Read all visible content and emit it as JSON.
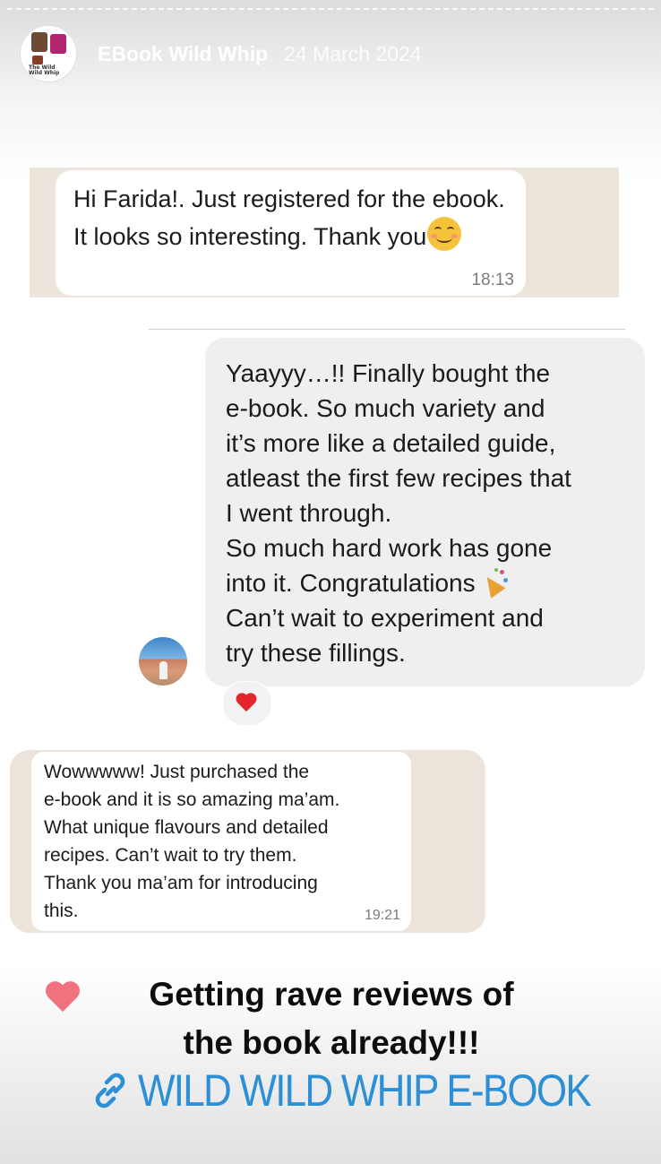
{
  "story": {
    "account_name": "EBook Wild Whip",
    "date": "24 March 2024",
    "avatar_text": "The Wild Wild Whip"
  },
  "messages": [
    {
      "text": "Hi Farida!. Just registered for the ebook. It looks so interesting.  Thank you",
      "emoji": "smiling-face-icon",
      "time": "18:13"
    },
    {
      "text": "Yaayyy…!! Finally bought the\ne-book. So much variety and\nit’s more like a detailed guide,\natleast the first few recipes that\nI went through.\nSo much hard work has gone\ninto it. Congratulations ",
      "text_end": "\nCan’t wait to experiment and\ntry these fillings.",
      "emoji": "party-popper-icon",
      "reaction": "red-heart-icon"
    },
    {
      "lines": [
        "Wowwwww! Just purchased the",
        "e-book and it is so amazing ma’am.",
        "What unique flavours and detailed",
        "recipes. Can’t wait to try them.",
        "Thank you ma’am for introducing",
        "this."
      ],
      "time": "19:21"
    }
  ],
  "caption": {
    "line1": "Getting rave reviews of",
    "line2": "the book already!!!"
  },
  "link_sticker": {
    "label": "WILD WILD WHIP E-BOOK",
    "icon": "link-icon",
    "color": "#2d8fd6"
  },
  "colors": {
    "heart_sticker": "#f0727f",
    "reaction_heart": "#e2262b"
  }
}
